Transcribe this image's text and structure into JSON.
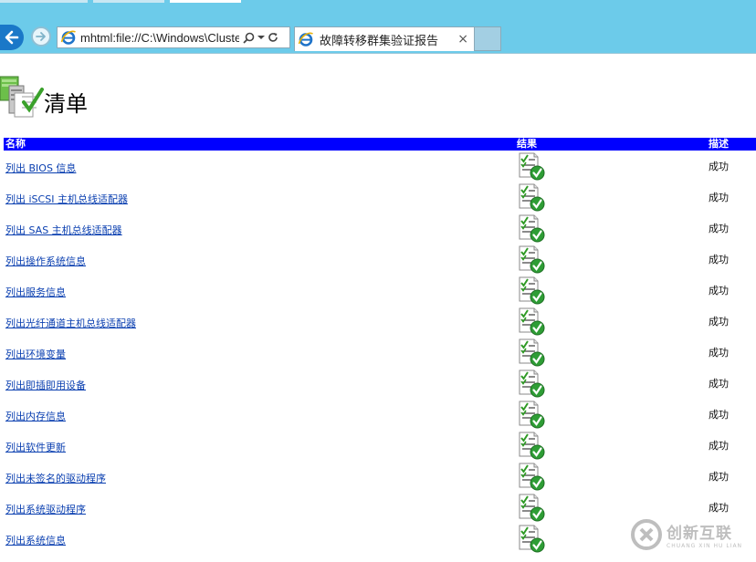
{
  "browser": {
    "address": "mhtml:file://C:\\Windows\\Cluster\\Reports\\",
    "tab_title": "故障转移群集验证报告",
    "tab_close": "×"
  },
  "page": {
    "title": "清单"
  },
  "table": {
    "headers": {
      "name": "名称",
      "result": "结果",
      "description": "描述"
    },
    "rows": [
      {
        "name": "列出 BIOS 信息",
        "description": "成功"
      },
      {
        "name": "列出 iSCSI 主机总线适配器",
        "description": "成功"
      },
      {
        "name": "列出 SAS 主机总线适配器",
        "description": "成功"
      },
      {
        "name": "列出操作系统信息",
        "description": "成功"
      },
      {
        "name": "列出服务信息",
        "description": "成功"
      },
      {
        "name": "列出光纤通道主机总线适配器",
        "description": "成功"
      },
      {
        "name": "列出环境变量",
        "description": "成功"
      },
      {
        "name": "列出即插即用设备",
        "description": "成功"
      },
      {
        "name": "列出内存信息",
        "description": "成功"
      },
      {
        "name": "列出软件更新",
        "description": "成功"
      },
      {
        "name": "列出未签名的驱动程序",
        "description": "成功"
      },
      {
        "name": "列出系统驱动程序",
        "description": "成功"
      },
      {
        "name": "列出系统信息",
        "description": ""
      }
    ]
  },
  "watermark": {
    "text": "创新互联",
    "subtext": "CHUANG XIN HU LIAN"
  }
}
